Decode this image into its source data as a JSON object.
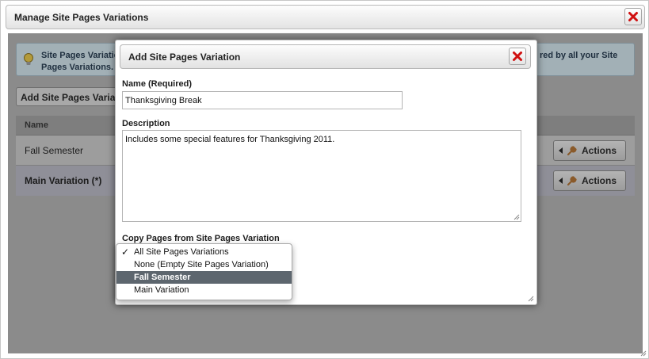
{
  "outer_dialog": {
    "title": "Manage Site Pages Variations",
    "close_label": "Close"
  },
  "info": {
    "text_left": "Site Pages Variatio… Pages Variations.",
    "text_right": "red by all your Site"
  },
  "add_button": {
    "label": "Add Site Pages Variatio"
  },
  "table": {
    "column_header": "Name",
    "rows": [
      {
        "name": "Fall Semester",
        "actions_label": "Actions"
      },
      {
        "name": "Main Variation (*)",
        "actions_label": "Actions"
      }
    ]
  },
  "inner_dialog": {
    "title": "Add Site Pages Variation",
    "name_label": "Name (Required)",
    "name_value": "Thanksgiving Break",
    "description_label": "Description",
    "description_value": "Includes some special features for Thanksgiving 2011.",
    "copy_label": "Copy Pages from Site Pages Variation",
    "options": [
      {
        "label": "All Site Pages Variations",
        "checked": true,
        "highlighted": false
      },
      {
        "label": "None (Empty Site Pages Variation)",
        "checked": false,
        "highlighted": false
      },
      {
        "label": "Fall Semester",
        "checked": false,
        "highlighted": true
      },
      {
        "label": "Main Variation",
        "checked": false,
        "highlighted": false
      }
    ],
    "checkmark": "✓"
  },
  "colors": {
    "overlay_gray": "#8b8b8b",
    "close_icon_red": "#d01010",
    "selected_option": "#5d666e"
  }
}
